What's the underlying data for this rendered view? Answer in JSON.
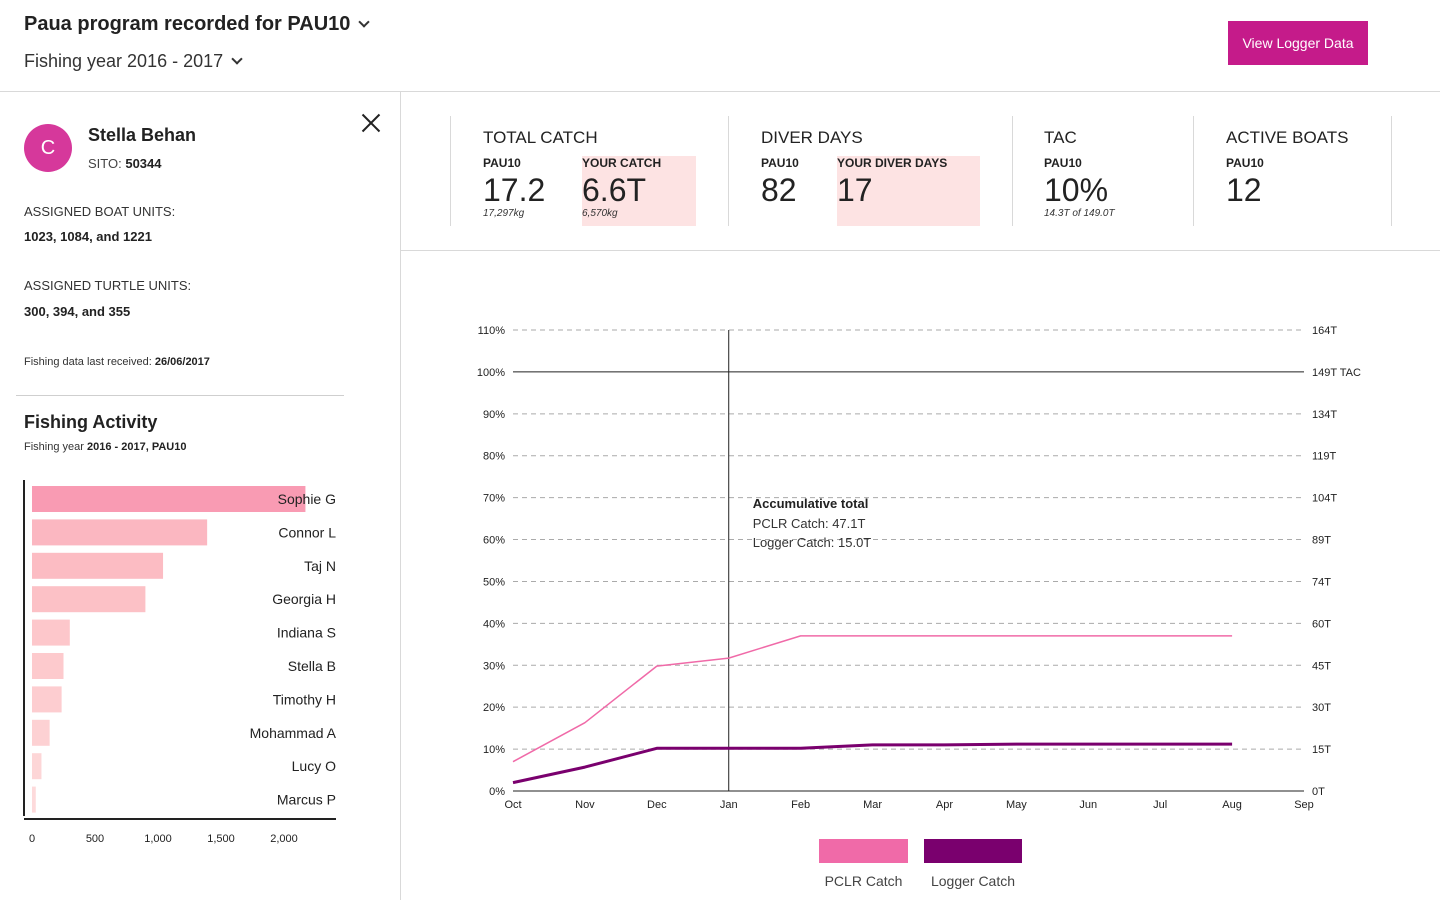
{
  "header": {
    "program_title": "Paua program recorded for PAU10",
    "fishing_year": "Fishing year 2016 - 2017",
    "view_logger_button": "View Logger Data"
  },
  "profile": {
    "avatar_letter": "C",
    "name": "Stella Behan",
    "sito_label": "SITO:",
    "sito_value": "50344",
    "boat_units_label": "ASSIGNED BOAT UNITS:",
    "boat_units_value": "1023, 1084, and 1221",
    "turtle_units_label": "ASSIGNED TURTLE UNITS:",
    "turtle_units_value": "300, 394, and 355",
    "last_received_label": "Fishing data last received:",
    "last_received_value": "26/06/2017"
  },
  "activity": {
    "title": "Fishing Activity",
    "subtitle_prefix": "Fishing year",
    "subtitle_value": "2016 - 2017, PAU10"
  },
  "stats": {
    "total_catch": {
      "title": "TOTAL CATCH",
      "area_label": "PAU10",
      "area_value": "17.2",
      "area_note": "17,297kg",
      "your_label": "YOUR CATCH",
      "your_value": "6.6T",
      "your_note": "6,570kg"
    },
    "diver_days": {
      "title": "DIVER DAYS",
      "area_label": "PAU10",
      "area_value": "82",
      "your_label": "YOUR DIVER DAYS",
      "your_value": "17"
    },
    "tac": {
      "title": "TAC",
      "area_label": "PAU10",
      "area_value": "10%",
      "area_note": "14.3T of 149.0T"
    },
    "active_boats": {
      "title": "ACTIVE BOATS",
      "area_label": "PAU10",
      "area_value": "12"
    }
  },
  "chart_data": [
    {
      "type": "bar",
      "orientation": "horizontal",
      "categories": [
        "Sophie G",
        "Connor L",
        "Taj N",
        "Georgia H",
        "Indiana S",
        "Stella B",
        "Timothy H",
        "Mohammad A",
        "Lucy O",
        "Marcus P"
      ],
      "values": [
        2170,
        1390,
        1040,
        900,
        300,
        250,
        235,
        140,
        75,
        30
      ],
      "xticks": [
        "0",
        "500",
        "1,000",
        "1,500",
        "2,000"
      ],
      "xlim": [
        0,
        2400
      ],
      "colors": [
        "#f99bb3",
        "#fbb7c1",
        "#fcbcc3",
        "#fcc1c6",
        "#fdc7cb",
        "#fdcacd",
        "#fdcdd0",
        "#fdd1d3",
        "#fdd6d7",
        "#fddadb"
      ]
    },
    {
      "type": "line",
      "x": [
        "Oct",
        "Nov",
        "Dec",
        "Jan",
        "Feb",
        "Mar",
        "Apr",
        "May",
        "Jun",
        "Jul",
        "Aug",
        "Sep"
      ],
      "y_left_ticks": [
        "0%",
        "10%",
        "20%",
        "30%",
        "40%",
        "50%",
        "60%",
        "70%",
        "80%",
        "90%",
        "100%",
        "110%"
      ],
      "y_right_ticks": [
        "0T",
        "15T",
        "30T",
        "45T",
        "60T",
        "74T",
        "89T",
        "104T",
        "119T",
        "134T",
        "149T TAC",
        "164T"
      ],
      "ylim": [
        0,
        110
      ],
      "series": [
        {
          "name": "PCLR Catch",
          "color": "#f06aa8",
          "values": [
            7,
            16.3,
            29.8,
            31.7,
            37,
            37,
            37,
            37,
            37,
            37,
            37
          ]
        },
        {
          "name": "Logger Catch",
          "color": "#7a006e",
          "values": [
            2,
            5.7,
            10.2,
            10.2,
            10.2,
            11,
            11,
            11.2,
            11.2,
            11.2,
            11.2
          ]
        }
      ],
      "hover_month": "Jan",
      "tooltip": {
        "title": "Accumulative total",
        "pclr": "PCLR Catch: 47.1T",
        "logger": "Logger Catch: 15.0T"
      },
      "legend_position": "bottom-center"
    }
  ]
}
